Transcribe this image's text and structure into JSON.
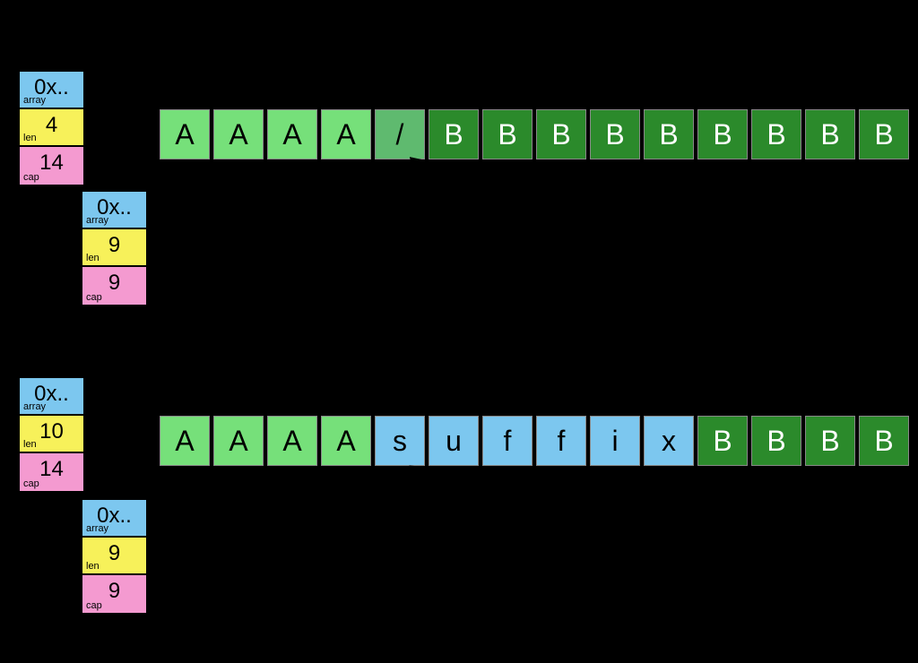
{
  "slice1": {
    "array_val": "0x..",
    "array_lab": "array",
    "len_val": "4",
    "len_lab": "len",
    "cap_val": "14",
    "cap_lab": "cap"
  },
  "slice2": {
    "array_val": "0x..",
    "array_lab": "array",
    "len_val": "9",
    "len_lab": "len",
    "cap_val": "9",
    "cap_lab": "cap"
  },
  "slice3": {
    "array_val": "0x..",
    "array_lab": "array",
    "len_val": "10",
    "len_lab": "len",
    "cap_val": "14",
    "cap_lab": "cap"
  },
  "slice4": {
    "array_val": "0x..",
    "array_lab": "array",
    "len_val": "9",
    "len_lab": "len",
    "cap_val": "9",
    "cap_lab": "cap"
  },
  "mem1": {
    "c0": "A",
    "c1": "A",
    "c2": "A",
    "c3": "A",
    "c4": "/",
    "c5": "B",
    "c6": "B",
    "c7": "B",
    "c8": "B",
    "c9": "B",
    "c10": "B",
    "c11": "B",
    "c12": "B",
    "c13": "B"
  },
  "mem2": {
    "c0": "A",
    "c1": "A",
    "c2": "A",
    "c3": "A",
    "c4": "s",
    "c5": "u",
    "c6": "f",
    "c7": "f",
    "c8": "i",
    "c9": "x",
    "c10": "B",
    "c11": "B",
    "c12": "B",
    "c13": "B"
  }
}
